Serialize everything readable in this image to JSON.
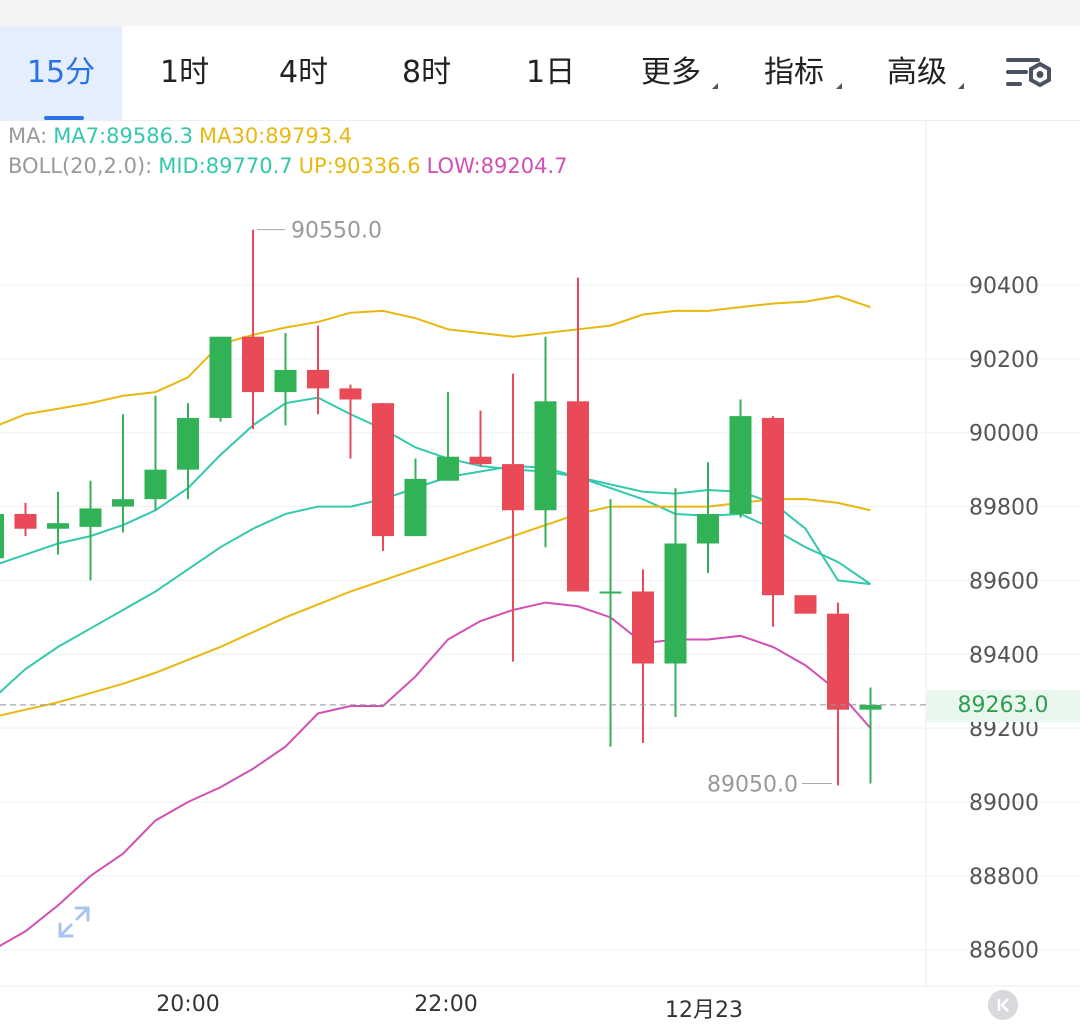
{
  "tabs": [
    {
      "label": "15分",
      "active": true
    },
    {
      "label": "1时"
    },
    {
      "label": "4时"
    },
    {
      "label": "8时"
    },
    {
      "label": "1日"
    },
    {
      "label": "更多",
      "dropdown": true
    },
    {
      "label": "指标",
      "dropdown": true
    },
    {
      "label": "高级",
      "dropdown": true
    }
  ],
  "legend": {
    "ma_label": "MA:",
    "ma7": "MA7:89586.3",
    "ma30": "MA30:89793.4",
    "boll_label": "BOLL(20,2.0):",
    "mid": "MID:89770.7",
    "up": "UP:90336.6",
    "low": "LOW:89204.7"
  },
  "colors": {
    "up": "#31b257",
    "down": "#e84a57",
    "ma7": "#34c8ad",
    "ma30_up": "#e8b811",
    "low": "#d24fb4",
    "active_tab": "#2b72e6"
  },
  "current_price": "89263.0",
  "high_marker": "90550.0",
  "low_marker": "89050.0",
  "x_labels": [
    "20:00",
    "22:00",
    "12月23"
  ],
  "y_ticks": [
    "90400",
    "90200",
    "90000",
    "89800",
    "89600",
    "89400",
    "89200",
    "89000",
    "88800",
    "88600"
  ],
  "chart_data": {
    "type": "candlestick",
    "interval": "15分",
    "ylim": [
      88500,
      90700
    ],
    "y_ticks": [
      90400,
      90200,
      90000,
      89800,
      89600,
      89400,
      89200,
      89000,
      88800,
      88600
    ],
    "x_tick_labels": [
      "20:00",
      "22:00",
      "12月23"
    ],
    "candles": [
      {
        "o": 89660,
        "h": 89800,
        "l": 89620,
        "c": 89780
      },
      {
        "o": 89780,
        "h": 89810,
        "l": 89720,
        "c": 89740
      },
      {
        "o": 89740,
        "h": 89840,
        "l": 89670,
        "c": 89755
      },
      {
        "o": 89745,
        "h": 89870,
        "l": 89600,
        "c": 89795
      },
      {
        "o": 89800,
        "h": 90050,
        "l": 89730,
        "c": 89820
      },
      {
        "o": 89820,
        "h": 90100,
        "l": 89790,
        "c": 89900
      },
      {
        "o": 89900,
        "h": 90080,
        "l": 89820,
        "c": 90040
      },
      {
        "o": 90040,
        "h": 90240,
        "l": 90030,
        "c": 90260
      },
      {
        "o": 90260,
        "h": 90550,
        "l": 90010,
        "c": 90110
      },
      {
        "o": 90110,
        "h": 90270,
        "l": 90020,
        "c": 90170
      },
      {
        "o": 90170,
        "h": 90290,
        "l": 90050,
        "c": 90120
      },
      {
        "o": 90120,
        "h": 90130,
        "l": 89930,
        "c": 90090
      },
      {
        "o": 90080,
        "h": 90080,
        "l": 89680,
        "c": 89720
      },
      {
        "o": 89720,
        "h": 89930,
        "l": 89720,
        "c": 89875
      },
      {
        "o": 89870,
        "h": 90110,
        "l": 89870,
        "c": 89935
      },
      {
        "o": 89935,
        "h": 90060,
        "l": 89910,
        "c": 89915
      },
      {
        "o": 89915,
        "h": 90160,
        "l": 89380,
        "c": 89790
      },
      {
        "o": 89790,
        "h": 90260,
        "l": 89690,
        "c": 90085
      },
      {
        "o": 90085,
        "h": 90420,
        "l": 89570,
        "c": 89570
      },
      {
        "o": 89570,
        "h": 89820,
        "l": 89150,
        "c": 89570
      },
      {
        "o": 89570,
        "h": 89630,
        "l": 89160,
        "c": 89375
      },
      {
        "o": 89375,
        "h": 89850,
        "l": 89230,
        "c": 89700
      },
      {
        "o": 89700,
        "h": 89920,
        "l": 89620,
        "c": 89780
      },
      {
        "o": 89780,
        "h": 90090,
        "l": 89770,
        "c": 90045
      },
      {
        "o": 90040,
        "h": 90045,
        "l": 89475,
        "c": 89560
      },
      {
        "o": 89560,
        "h": 89560,
        "l": 89520,
        "c": 89510
      },
      {
        "o": 89510,
        "h": 89540,
        "l": 89045,
        "c": 89250
      },
      {
        "o": 89250,
        "h": 89310,
        "l": 89050,
        "c": 89263
      }
    ],
    "series": [
      {
        "name": "MA7",
        "color": "#34c8ad",
        "values": [
          89640,
          89670,
          89700,
          89720,
          89750,
          89790,
          89850,
          89940,
          90020,
          90080,
          90095,
          90050,
          90010,
          89960,
          89930,
          89910,
          89900,
          89895,
          89880,
          89860,
          89840,
          89835,
          89845,
          89840,
          89810,
          89740,
          89600,
          89590
        ]
      },
      {
        "name": "MID",
        "color": "#34c8ad",
        "values": [
          89280,
          89360,
          89420,
          89470,
          89520,
          89570,
          89630,
          89690,
          89740,
          89780,
          89800,
          89800,
          89820,
          89850,
          89880,
          89895,
          89910,
          89905,
          89880,
          89850,
          89820,
          89780,
          89775,
          89780,
          89740,
          89690,
          89650,
          89590
        ]
      },
      {
        "name": "MA30",
        "color": "#e8b811",
        "values": [
          89230,
          89250,
          89270,
          89295,
          89320,
          89350,
          89385,
          89420,
          89460,
          89500,
          89535,
          89570,
          89600,
          89630,
          89660,
          89690,
          89720,
          89750,
          89780,
          89800,
          89800,
          89800,
          89800,
          89810,
          89820,
          89820,
          89810,
          89790
        ]
      },
      {
        "name": "UP",
        "color": "#e8b811",
        "values": [
          90015,
          90050,
          90065,
          90080,
          90100,
          90110,
          90150,
          90240,
          90265,
          90285,
          90300,
          90325,
          90330,
          90310,
          90280,
          90270,
          90260,
          90270,
          90280,
          90290,
          90320,
          90330,
          90330,
          90340,
          90350,
          90355,
          90370,
          90340
        ]
      },
      {
        "name": "LOW",
        "color": "#d24fb4",
        "values": [
          88600,
          88650,
          88720,
          88800,
          88860,
          88950,
          89000,
          89040,
          89090,
          89150,
          89240,
          89260,
          89260,
          89340,
          89440,
          89490,
          89520,
          89540,
          89530,
          89500,
          89430,
          89440,
          89440,
          89450,
          89420,
          89370,
          89300,
          89200
        ]
      }
    ]
  }
}
